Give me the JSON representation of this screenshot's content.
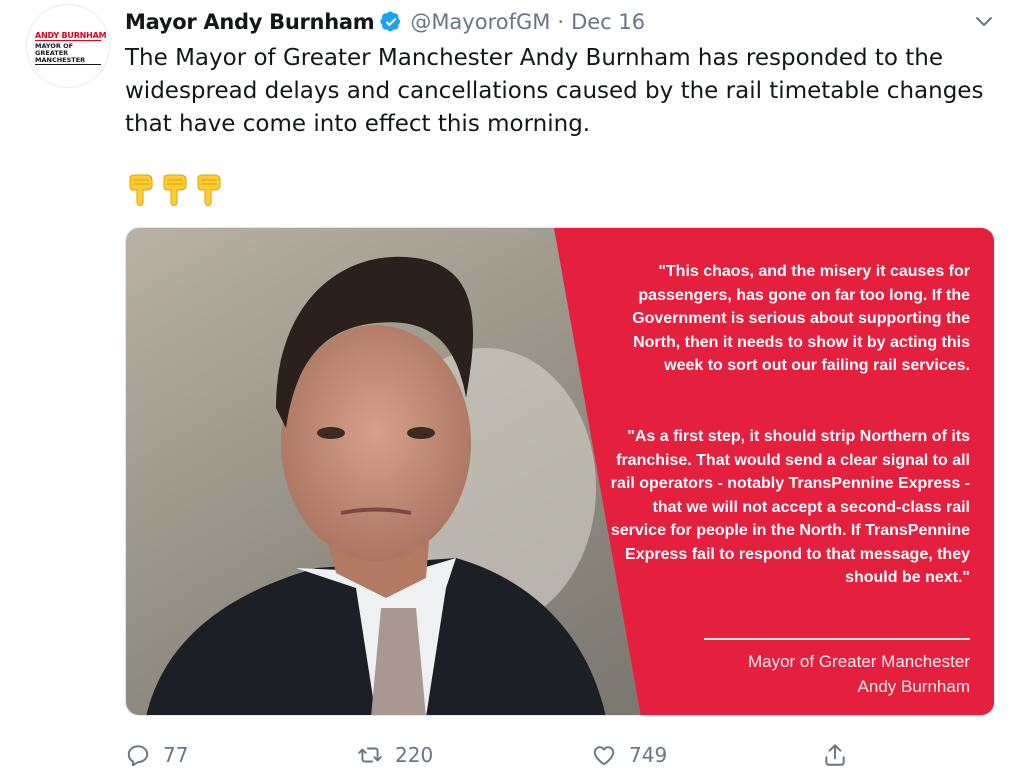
{
  "avatar": {
    "line1": "ANDY BURNHAM",
    "line2": "MAYOR OF\nGREATER\nMANCHESTER"
  },
  "tweet": {
    "display_name": "Mayor Andy Burnham",
    "handle": "@MayorofGM",
    "separator": "·",
    "date": "Dec 16",
    "text": "The Mayor of Greater Manchester Andy Burnham has responded to the widespread delays and cancellations caused by the rail timetable changes that have come into effect this morning."
  },
  "emoji_count": 3,
  "image": {
    "quote1": "\"This chaos, and the misery it causes for passengers, has gone on far too long. If the Government is serious about supporting the North, then it needs to show it by acting this week to sort out our failing rail services.",
    "quote2": "\"As a first step, it should strip Northern of its franchise. That would send a clear signal to all rail operators - notably TransPennine Express - that we will not accept a second-class rail service for people in the North. If TransPennine Express fail to respond to that message, they should be next.\"",
    "attribution_line1": "Mayor of Greater Manchester",
    "attribution_line2": "Andy Burnham",
    "accent_color": "#e5203f"
  },
  "actions": {
    "replies": "77",
    "retweets": "220",
    "likes": "749"
  },
  "icons": [
    "verified-badge-icon",
    "chevron-down-icon",
    "pointing-down-emoji-icon",
    "reply-icon",
    "retweet-icon",
    "like-icon",
    "share-icon"
  ]
}
